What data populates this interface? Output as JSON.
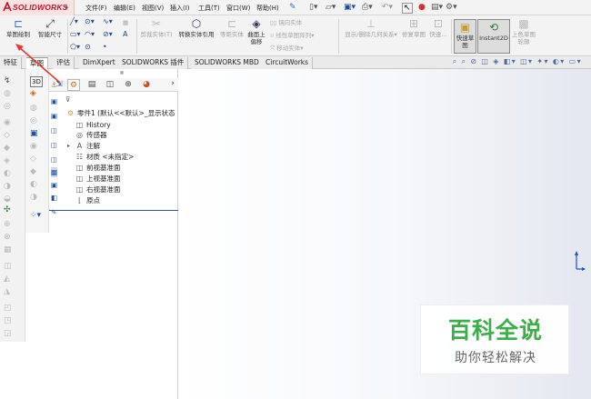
{
  "app": {
    "logo_text": "SOLIDWORKS",
    "logo_arrow": "▸",
    "brand_color": "#c8102e"
  },
  "menu": {
    "items": [
      "文件(F)",
      "编辑(E)",
      "视图(V)",
      "插入(I)",
      "工具(T)",
      "窗口(W)",
      "帮助(H)"
    ],
    "pin_icon": "pin-icon"
  },
  "command_manager": {
    "sketch_label": "草图绘制",
    "smart_dimension_label": "智能尺寸",
    "trim_entities_label": "剪裁实体(T)",
    "convert_entities_label": "转换实体引用",
    "offset_entities_label": "等距实体",
    "offset_surface_label_1": "曲面上",
    "offset_surface_label_2": "偏移",
    "mirror_entities_label": "镜向实体",
    "linear_pattern_label": "线性草图阵列",
    "move_entities_label": "移动实体",
    "display_relations_label": "显示/删除几何关系",
    "repair_sketch_label": "修复草图",
    "quick_snaps_label": "快速...",
    "rapid_sketch_label": "快速草图",
    "instant2d_label": "Instant2D",
    "shaded_sketch_label": "上色草图轮廓"
  },
  "tabs": {
    "items": [
      "特征",
      "草图",
      "评估",
      "DimXpert",
      "SOLIDWORKS 插件",
      "SOLIDWORKS MBD",
      "CircuitWorks"
    ],
    "active_index": 1
  },
  "feature_tree": {
    "root": "零件1  (默认<<默认>_显示状态",
    "items": [
      "History",
      "传感器",
      "注解",
      "材质 <未指定>",
      "前视基准面",
      "上视基准面",
      "右视基准面",
      "原点"
    ],
    "selection_line_color": "#2a56b8"
  },
  "watermark": {
    "title": "百科全说",
    "subtitle": "助你轻松解决",
    "title_color": "#3cae4a"
  },
  "annotation": {
    "arrow_color": "#e53935"
  }
}
